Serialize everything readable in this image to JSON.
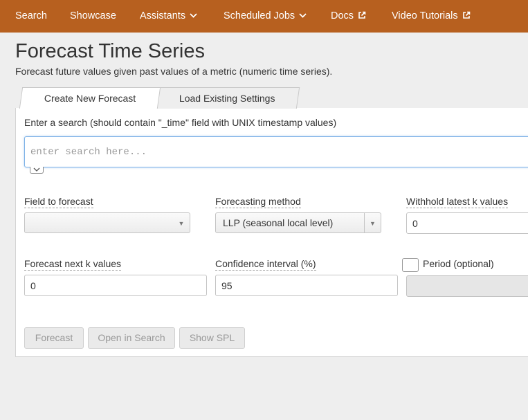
{
  "nav": {
    "items": [
      {
        "label": "Search"
      },
      {
        "label": "Showcase"
      },
      {
        "label": "Assistants"
      },
      {
        "label": "Scheduled Jobs"
      },
      {
        "label": "Docs"
      },
      {
        "label": "Video Tutorials"
      }
    ]
  },
  "page": {
    "title": "Forecast Time Series",
    "subtitle": "Forecast future values given past values of a metric (numeric time series)."
  },
  "tabs": [
    {
      "label": "Create New Forecast",
      "active": true
    },
    {
      "label": "Load Existing Settings",
      "active": false
    }
  ],
  "search": {
    "label": "Enter a search (should contain \"_time\" field with UNIX timestamp values)",
    "placeholder": "enter search here...",
    "value": ""
  },
  "fields": {
    "field_to_forecast": {
      "label": "Field to forecast",
      "value": ""
    },
    "forecasting_method": {
      "label": "Forecasting method",
      "value": "LLP (seasonal local level)"
    },
    "withhold_latest": {
      "label": "Withhold latest k values",
      "value": "0"
    },
    "forecast_next": {
      "label": "Forecast next k values",
      "value": "0"
    },
    "confidence_interval": {
      "label": "Confidence interval (%)",
      "value": "95"
    },
    "period": {
      "label": "Period (optional)",
      "value": "",
      "checked": false
    }
  },
  "buttons": {
    "forecast": "Forecast",
    "open_in_search": "Open in Search",
    "show_spl": "Show SPL"
  },
  "colors": {
    "nav_background": "#b7601f",
    "focus_border": "#7cb1e6"
  }
}
